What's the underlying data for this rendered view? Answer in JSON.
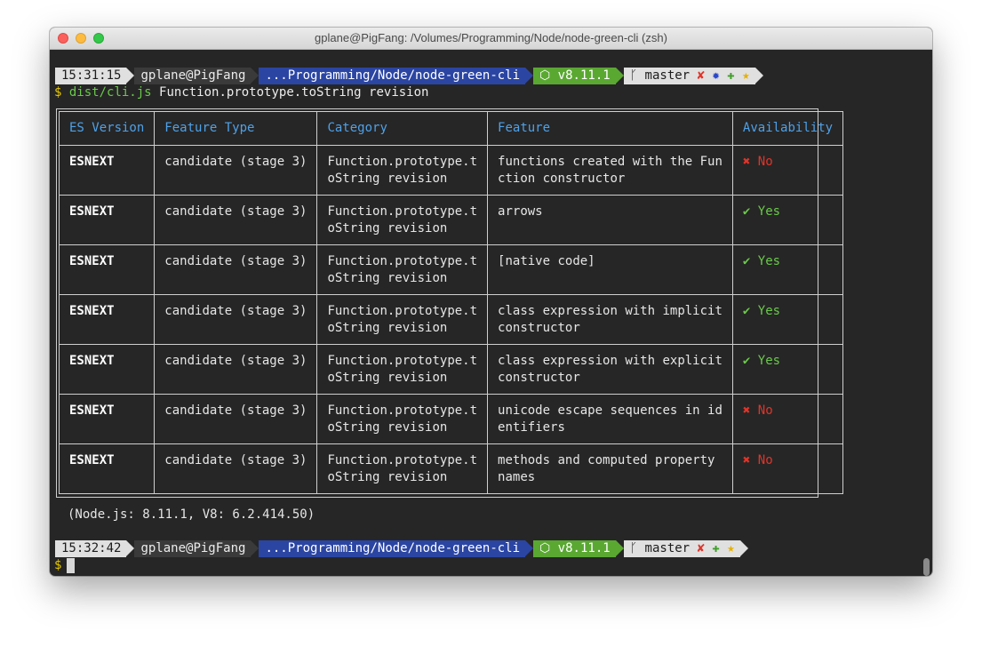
{
  "window": {
    "title": "gplane@PigFang: /Volumes/Programming/Node/node-green-cli (zsh)"
  },
  "prompt1": {
    "time": "15:31:15",
    "user": "gplane@PigFang",
    "path": "...Programming/Node/node-green-cli",
    "node": "⬡ v8.11.1",
    "git_icon": "ᚴ",
    "branch": "master",
    "status": [
      "✘",
      "✹",
      "✚",
      "★"
    ]
  },
  "command": {
    "dollar": "$",
    "exe": "dist/cli.js",
    "args": "Function.prototype.toString revision"
  },
  "table": {
    "headers": [
      "ES Version",
      "Feature Type",
      "Category",
      "Feature",
      "Availability"
    ],
    "rows": [
      [
        "ESNEXT",
        "candidate (stage 3)",
        "Function.prototype.t\noString revision",
        "functions created with the Fun\nction constructor",
        "✖ No"
      ],
      [
        "ESNEXT",
        "candidate (stage 3)",
        "Function.prototype.t\noString revision",
        "arrows",
        "✔ Yes"
      ],
      [
        "ESNEXT",
        "candidate (stage 3)",
        "Function.prototype.t\noString revision",
        "[native code]",
        "✔ Yes"
      ],
      [
        "ESNEXT",
        "candidate (stage 3)",
        "Function.prototype.t\noString revision",
        "class expression with implicit\nconstructor",
        "✔ Yes"
      ],
      [
        "ESNEXT",
        "candidate (stage 3)",
        "Function.prototype.t\noString revision",
        "class expression with explicit\nconstructor",
        "✔ Yes"
      ],
      [
        "ESNEXT",
        "candidate (stage 3)",
        "Function.prototype.t\noString revision",
        "unicode escape sequences in id\nentifiers",
        "✖ No"
      ],
      [
        "ESNEXT",
        "candidate (stage 3)",
        "Function.prototype.t\noString revision",
        "methods and computed property\nnames",
        "✖ No"
      ]
    ]
  },
  "footer": "(Node.js: 8.11.1, V8: 6.2.414.50)",
  "prompt2": {
    "time": "15:32:42",
    "user": "gplane@PigFang",
    "path": "...Programming/Node/node-green-cli",
    "node": "⬡ v8.11.1",
    "git_icon": "ᚴ",
    "branch": "master",
    "status": [
      "✘",
      "✚",
      "★"
    ]
  },
  "prompt_dollar": "$"
}
